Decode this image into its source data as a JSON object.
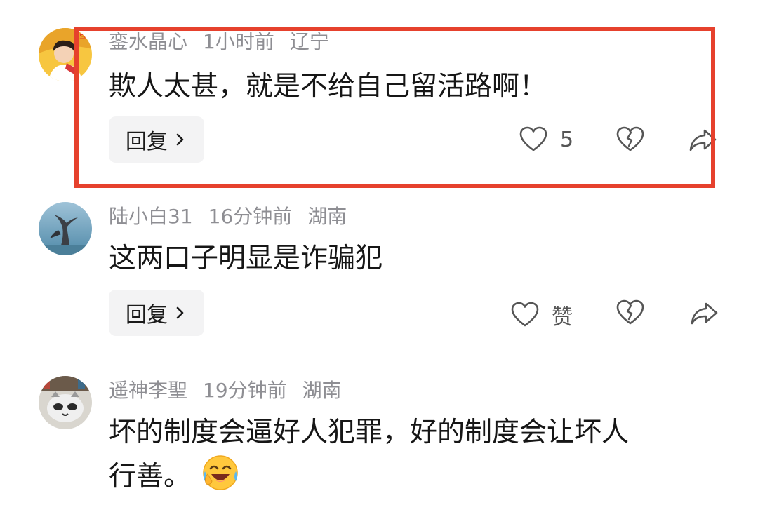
{
  "comments": [
    {
      "username": "銮水晶心",
      "time": "1小时前",
      "location": "辽宁",
      "text": "欺人太甚，就是不给自己留活路啊！",
      "reply_label": "回复",
      "likes": "5",
      "highlighted": true
    },
    {
      "username": "陆小白31",
      "time": "16分钟前",
      "location": "湖南",
      "text": "这两口子明显是诈骗犯",
      "reply_label": "回复",
      "likes": "赞"
    },
    {
      "username": "遥神李聖",
      "time": "19分钟前",
      "location": "湖南",
      "text_line1": "坏的制度会逼好人犯罪，好的制度会让坏人",
      "text_line2": "行善。"
    }
  ],
  "colors": {
    "highlight_border": "#e6412d",
    "meta_text": "#8e8e93",
    "reply_bg": "#f3f3f4"
  },
  "icons": [
    "heart-icon",
    "broken-heart-icon",
    "share-icon",
    "chevron-right-icon",
    "laughing-crying-emoji"
  ]
}
